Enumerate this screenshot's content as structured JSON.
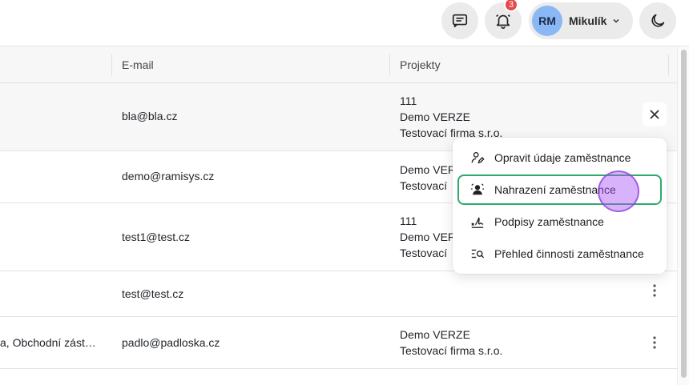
{
  "topbar": {
    "notifications_count": "3",
    "user": {
      "initials": "RM",
      "name": "Mikulík"
    }
  },
  "table": {
    "columns": [
      "E-mail",
      "Projekty"
    ],
    "rows": [
      {
        "role": "",
        "email": "bla@bla.cz",
        "projects": [
          "111",
          "Demo VERZE",
          "Testovací firma s.r.o."
        ]
      },
      {
        "role": "",
        "email": "demo@ramisys.cz",
        "projects": [
          "Demo VER",
          "Testovací"
        ]
      },
      {
        "role": "",
        "email": "test1@test.cz",
        "projects": [
          "111",
          "Demo VER",
          "Testovací"
        ]
      },
      {
        "role": "",
        "email": "test@test.cz",
        "projects": []
      },
      {
        "role": "a, Obchodní zást…",
        "email": "padlo@padloska.cz",
        "projects": [
          "Demo VERZE",
          "Testovací firma s.r.o."
        ]
      }
    ]
  },
  "context_menu": {
    "items": [
      {
        "label": "Opravit údaje zaměstnance",
        "icon": "user-edit-icon"
      },
      {
        "label": "Nahrazení zaměstnance",
        "icon": "user-replace-icon"
      },
      {
        "label": "Podpisy zaměstnance",
        "icon": "signature-icon"
      },
      {
        "label": "Přehled činnosti zaměstnance",
        "icon": "activity-search-icon"
      }
    ]
  },
  "colors": {
    "accent_border": "#2eaa6a",
    "badge": "#e5484d",
    "avatar": "#8ab8f5",
    "cursor": "#a855f7"
  }
}
